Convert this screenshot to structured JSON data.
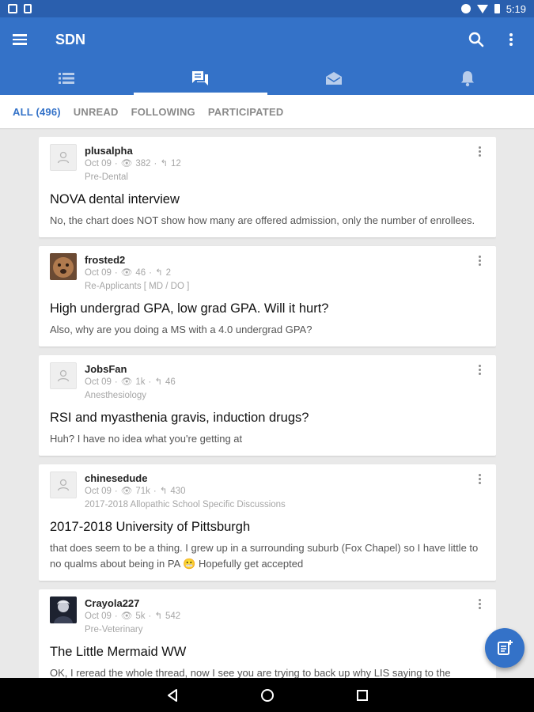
{
  "status_bar": {
    "time": "5:19"
  },
  "app_bar": {
    "title": "SDN",
    "tabs": [
      {
        "icon": "list-icon",
        "active": false
      },
      {
        "icon": "chat-icon",
        "active": true
      },
      {
        "icon": "mail-icon",
        "active": false
      },
      {
        "icon": "bell-icon",
        "active": false
      }
    ]
  },
  "filters": [
    {
      "label": "ALL (496)",
      "active": true
    },
    {
      "label": "UNREAD",
      "active": false
    },
    {
      "label": "FOLLOWING",
      "active": false
    },
    {
      "label": "PARTICIPATED",
      "active": false
    }
  ],
  "threads": [
    {
      "username": "plusalpha",
      "date": "Oct 09",
      "views": "382",
      "replies": "12",
      "forum": "Pre-Dental",
      "title": "NOVA dental interview",
      "snippet": "No, the chart does NOT show how many are offered admission, only the number of enrollees."
    },
    {
      "username": "frosted2",
      "date": "Oct 09",
      "views": "46",
      "replies": "2",
      "forum": "Re-Applicants [ MD / DO ]",
      "title": "High undergrad GPA, low grad GPA. Will it hurt?",
      "snippet": "Also, why are you doing a MS with a 4.0 undergrad GPA?"
    },
    {
      "username": "JobsFan",
      "date": "Oct 09",
      "views": "1k",
      "replies": "46",
      "forum": "Anesthesiology",
      "title": "RSI and myasthenia gravis, induction drugs?",
      "snippet": "Huh? I have no idea what you're getting at"
    },
    {
      "username": "chinesedude",
      "date": "Oct 09",
      "views": "71k",
      "replies": "430",
      "forum": "2017-2018 Allopathic School Specific Discussions",
      "title": "2017-2018 University of Pittsburgh",
      "snippet": "that does seem to be a thing. I grew up in a surrounding suburb (Fox Chapel) so I have little to no qualms about being in PA 😬 Hopefully get accepted"
    },
    {
      "username": "Crayola227",
      "date": "Oct 09",
      "views": "5k",
      "replies": "542",
      "forum": "Pre-Veterinary",
      "title": "The Little Mermaid WW",
      "snippet": "OK, I reread the whole thread, now I see you are trying to back up why LIS saying to the"
    }
  ]
}
